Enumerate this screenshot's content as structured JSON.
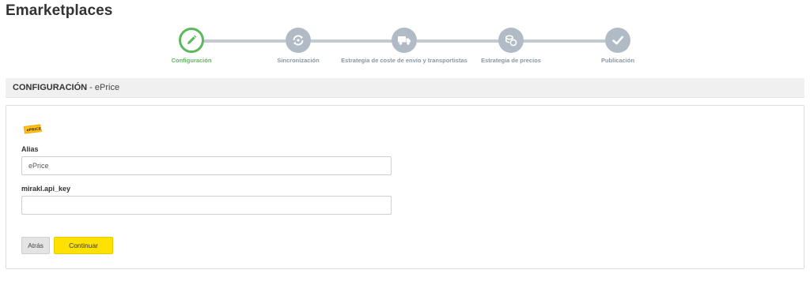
{
  "app": {
    "title": "Emarketplaces"
  },
  "stepper": {
    "steps": [
      {
        "label": "Configuración",
        "icon": "pencil-icon",
        "state": "active"
      },
      {
        "label": "Sincronización",
        "icon": "sync-icon",
        "state": "pending"
      },
      {
        "label": "Estrategia de coste de envío y transportistas",
        "icon": "truck-icon",
        "state": "pending"
      },
      {
        "label": "Estrategia de precios",
        "icon": "coins-icon",
        "state": "pending"
      },
      {
        "label": "Publicación",
        "icon": "check-icon",
        "state": "pending"
      }
    ],
    "colors": {
      "active": "#5cb85c",
      "pending": "#b0bbc6",
      "line": "#c3cbd2"
    }
  },
  "section": {
    "title": "CONFIGURACIÓN",
    "subtitle": "- ePrice"
  },
  "marketplace": {
    "logo_text": "ePRICE"
  },
  "form": {
    "alias": {
      "label": "Alias",
      "value": "ePrice",
      "placeholder": ""
    },
    "api_key": {
      "label": "mirakl.api_key",
      "value": "",
      "placeholder": ""
    }
  },
  "buttons": {
    "back": "Atrás",
    "continue": "Continuar"
  },
  "colors": {
    "accent": "#ffe100",
    "panel_header": "#f0f0f0"
  }
}
